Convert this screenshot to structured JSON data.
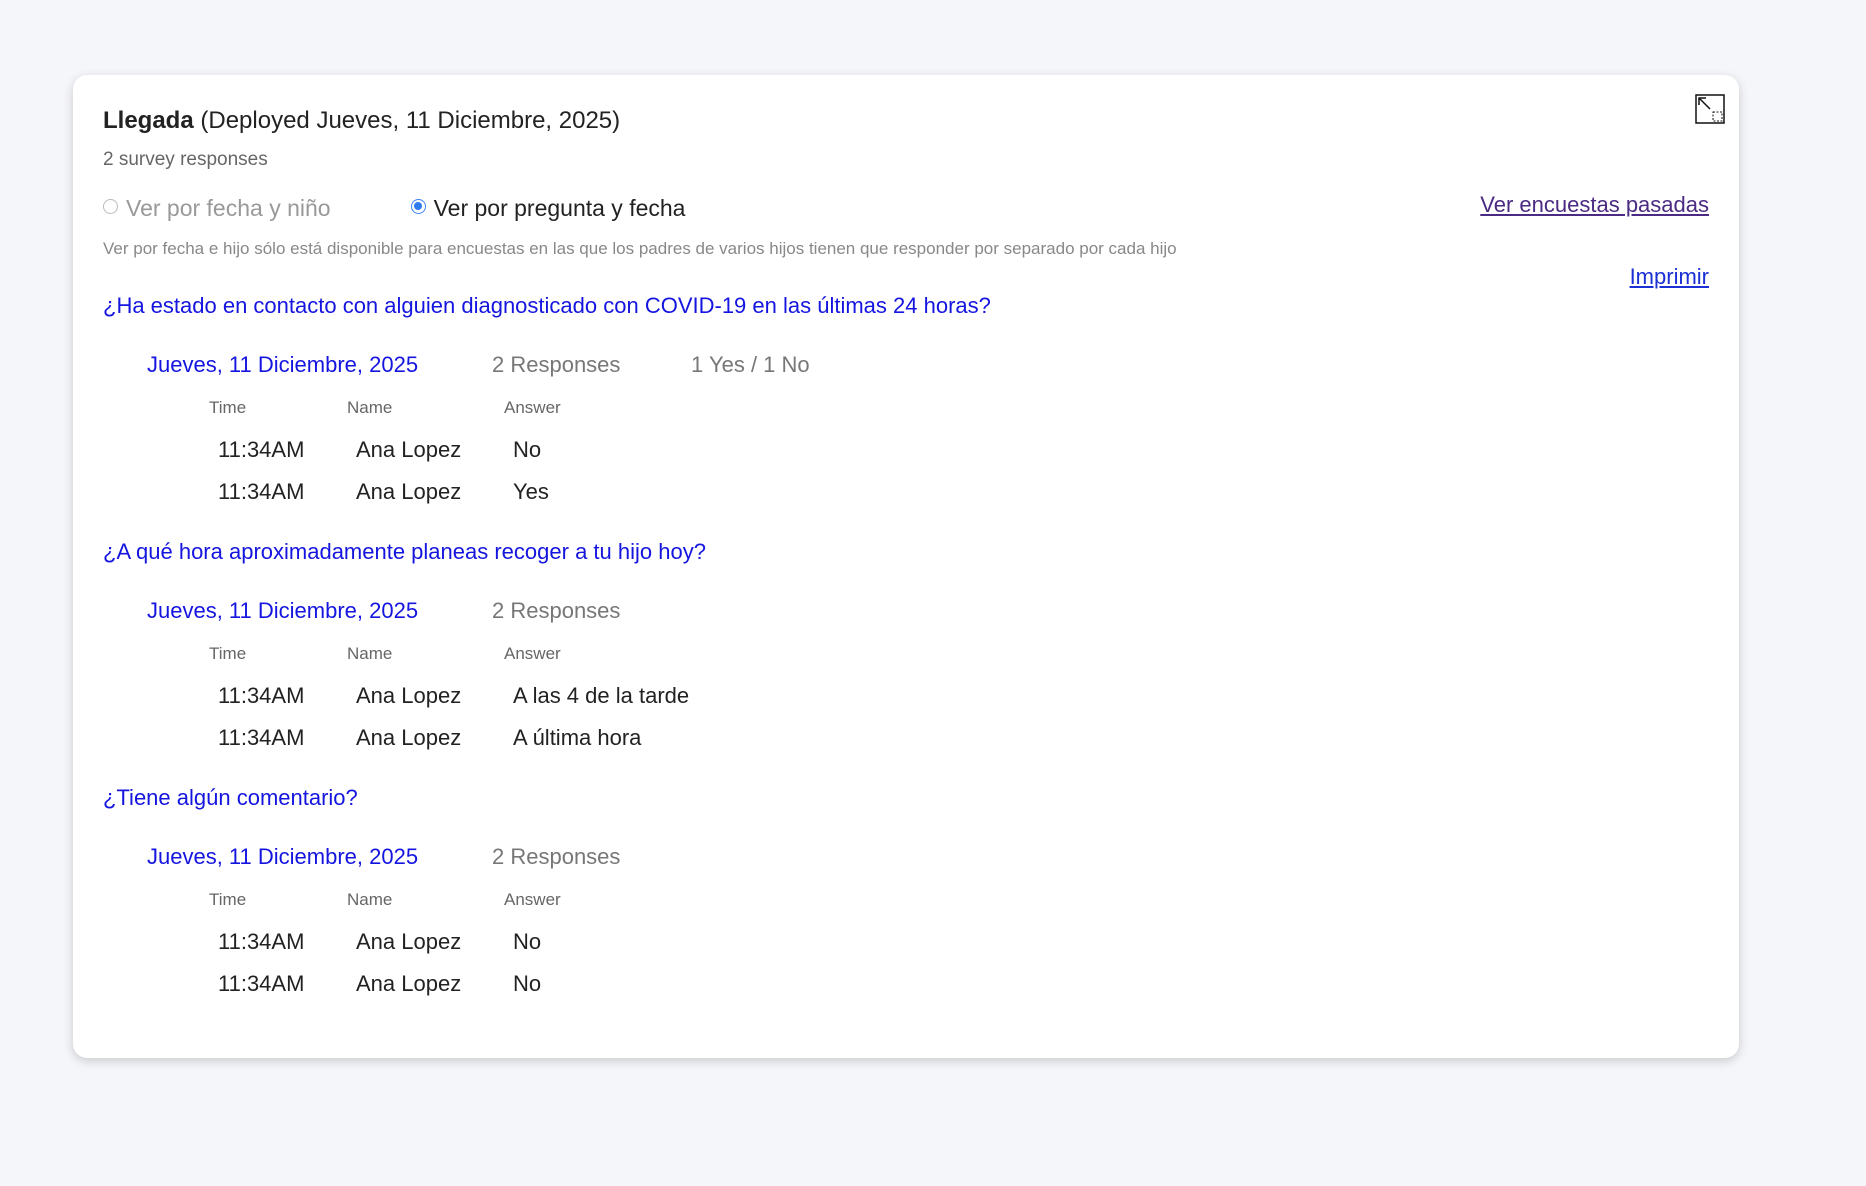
{
  "survey": {
    "title": "Llegada",
    "deployed": "(Deployed Jueves, 11 Diciembre, 2025)",
    "response_count": "2 survey responses"
  },
  "view_options": {
    "by_date_child": "Ver por fecha y niño",
    "by_question_date": "Ver por pregunta y fecha",
    "selected": "by_question_date"
  },
  "links": {
    "past_surveys": "Ver encuestas pasadas",
    "print": "Imprimir"
  },
  "note": "Ver por fecha e hijo sólo está disponible para encuestas en las que los padres de varios hijos tienen que responder por separado por cada hijo",
  "table_headers": {
    "time": "Time",
    "name": "Name",
    "answer": "Answer"
  },
  "questions": [
    {
      "text": "¿Ha estado en contacto con alguien diagnosticado con COVID-19 en las últimas 24 horas?",
      "date": "Jueves, 11 Diciembre, 2025",
      "responses_label": "2 Responses",
      "summary": "1 Yes / 1 No",
      "rows": [
        {
          "time": "11:34AM",
          "name": "Ana Lopez",
          "answer": "No"
        },
        {
          "time": "11:34AM",
          "name": "Ana Lopez",
          "answer": "Yes"
        }
      ]
    },
    {
      "text": "¿A qué hora aproximadamente planeas recoger a tu hijo hoy?",
      "date": "Jueves, 11 Diciembre, 2025",
      "responses_label": "2 Responses",
      "rows": [
        {
          "time": "11:34AM",
          "name": "Ana Lopez",
          "answer": "A las 4 de la tarde"
        },
        {
          "time": "11:34AM",
          "name": "Ana Lopez",
          "answer": "A última hora"
        }
      ]
    },
    {
      "text": "¿Tiene algún comentario?",
      "date": "Jueves, 11 Diciembre, 2025",
      "responses_label": "2 Responses",
      "rows": [
        {
          "time": "11:34AM",
          "name": "Ana Lopez",
          "answer": "No"
        },
        {
          "time": "11:34AM",
          "name": "Ana Lopez",
          "answer": "No"
        }
      ]
    }
  ],
  "icons": {
    "expand": "expand-icon"
  }
}
